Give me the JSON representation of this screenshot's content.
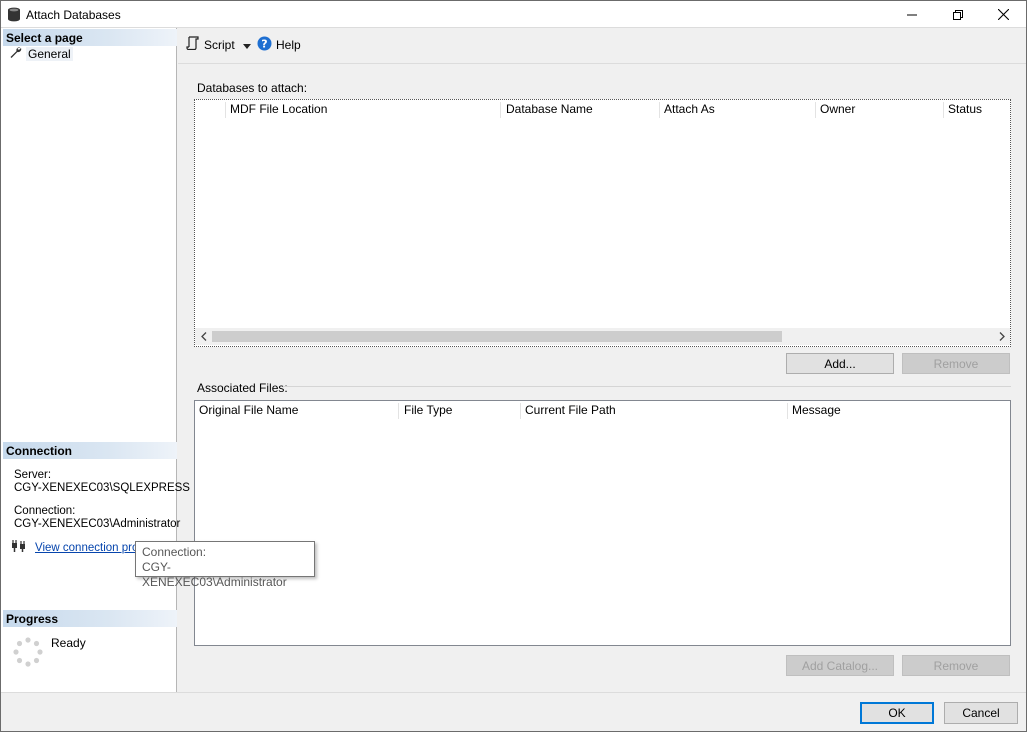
{
  "window": {
    "title": "Attach Databases"
  },
  "left": {
    "select_page_header": "Select a page",
    "general_label": "General",
    "connection_header": "Connection",
    "server_label": "Server:",
    "server_value": "CGY-XENEXEC03\\SQLEXPRESS",
    "connection_label": "Connection:",
    "connection_value": "CGY-XENEXEC03\\Administrator",
    "view_connection_link": "View connection properties",
    "progress_header": "Progress",
    "progress_status": "Ready"
  },
  "toolbar": {
    "script_label": "Script",
    "help_label": "Help"
  },
  "databases": {
    "label": "Databases to attach:",
    "columns": [
      "MDF File Location",
      "Database Name",
      "Attach As",
      "Owner",
      "Status"
    ],
    "add_button": "Add...",
    "remove_button": "Remove"
  },
  "files": {
    "label": "Associated Files:",
    "columns": [
      "Original File Name",
      "File Type",
      "Current File Path",
      "Message"
    ],
    "add_catalog_button": "Add Catalog...",
    "remove_button": "Remove"
  },
  "dialog": {
    "ok": "OK",
    "cancel": "Cancel"
  },
  "tooltip": {
    "line1": "Connection:",
    "line2": "CGY-XENEXEC03\\Administrator"
  },
  "colors": {
    "accent": "#0078d7",
    "link": "#0645ad",
    "section_header": "#c6d9ec"
  },
  "icons": {
    "app": "database-icon",
    "minimize": "minimize-icon",
    "maximize": "restore-icon",
    "close": "close-icon",
    "general": "wrench-icon",
    "script": "script-icon",
    "dropdown": "chevron-down-icon",
    "help": "help-icon",
    "connection": "plug-icon",
    "progress": "spinner-icon"
  }
}
